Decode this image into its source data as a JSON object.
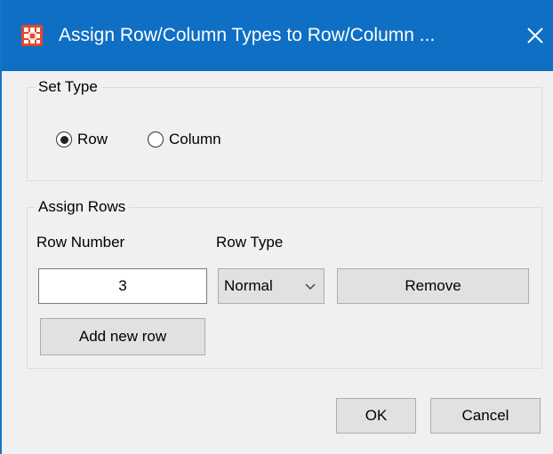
{
  "window": {
    "title": "Assign Row/Column Types to Row/Column ...",
    "close_icon": "close-icon",
    "app_icon": "app-grid-icon",
    "title_bar_color": "#0e6fc5"
  },
  "set_type": {
    "legend": "Set Type",
    "options": [
      {
        "label": "Row",
        "selected": true
      },
      {
        "label": "Column",
        "selected": false
      }
    ]
  },
  "assign_rows": {
    "legend": "Assign Rows",
    "row_number_label": "Row Number",
    "row_type_label": "Row Type",
    "row_number_value": "3",
    "row_type_value": "Normal",
    "remove_label": "Remove",
    "add_new_row_label": "Add new row"
  },
  "footer": {
    "ok_label": "OK",
    "cancel_label": "Cancel"
  }
}
